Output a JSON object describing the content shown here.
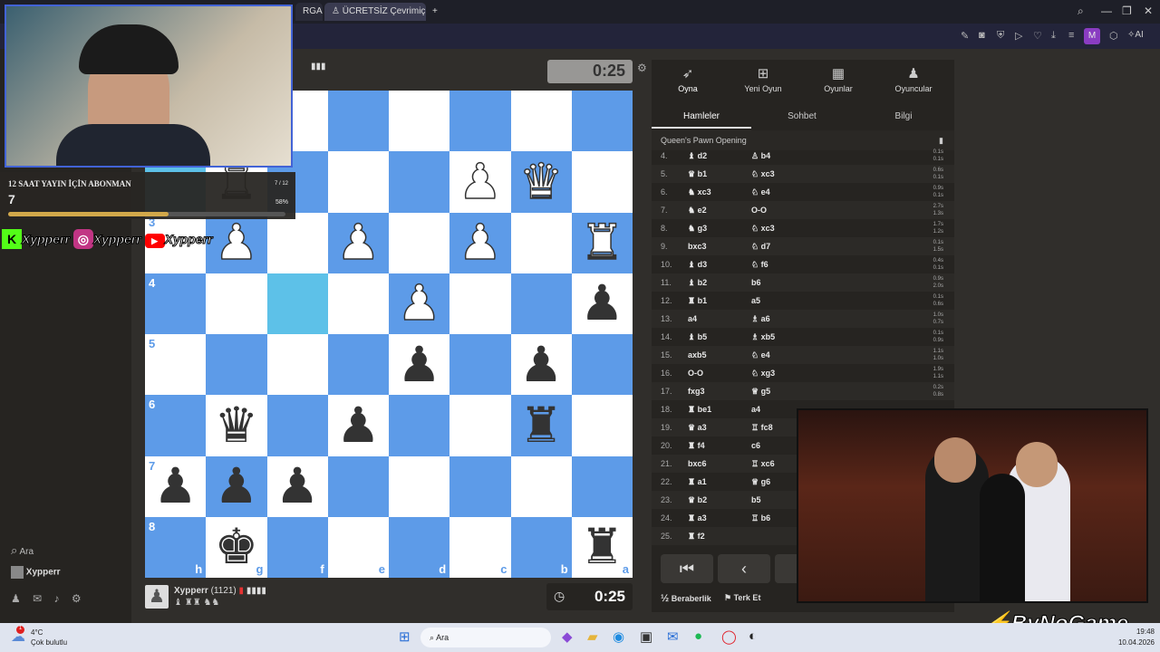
{
  "browser": {
    "tab_partial": "RGANİZ",
    "tab_active": "ÜCRETSİZ Çevrimiçi S...",
    "new_tab": "+",
    "profile_initial": "M",
    "ai_label": "AI"
  },
  "overlay": {
    "banner_title": "12 SAAT YAYIN İÇİN ABONMAN",
    "banner_count": "7",
    "banner_fraction": "7 / 12",
    "banner_percent": "58%",
    "progress": 0.58,
    "social_handles": [
      "Xypperr",
      "Xypperr",
      "Xypperr"
    ],
    "watermark": "ByNoGame"
  },
  "game": {
    "top_clock": "0:25",
    "bottom_clock": "0:25",
    "player_name": "Xypperr",
    "player_rating": "(1121)",
    "board": [
      [
        "",
        "",
        "",
        "",
        "",
        "",
        "",
        ""
      ],
      [
        "",
        "wR",
        "",
        "",
        "",
        "wP",
        "wQ",
        ""
      ],
      [
        "",
        "wP",
        "",
        "wP",
        "",
        "wP",
        "",
        "wR"
      ],
      [
        "",
        "",
        "",
        "",
        "wP",
        "",
        "",
        "bP"
      ],
      [
        "",
        "",
        "",
        "",
        "bP",
        "",
        "bP",
        ""
      ],
      [
        "",
        "bQ",
        "",
        "bP",
        "",
        "",
        "bR",
        ""
      ],
      [
        "bP",
        "bP",
        "bP",
        "",
        "",
        "",
        "",
        ""
      ],
      [
        "",
        "bK",
        "",
        "",
        "",
        "",
        "",
        "bR"
      ]
    ],
    "ranks": [
      "",
      "",
      "3",
      "4",
      "5",
      "6",
      "7",
      "8"
    ],
    "files": [
      "h",
      "g",
      "f",
      "e",
      "d",
      "c",
      "b",
      "a"
    ]
  },
  "panel": {
    "nav": [
      {
        "label": "Oyna",
        "icon": "play-icon"
      },
      {
        "label": "Yeni Oyun",
        "icon": "plus-icon"
      },
      {
        "label": "Oyunlar",
        "icon": "board-icon"
      },
      {
        "label": "Oyuncular",
        "icon": "players-icon"
      }
    ],
    "subtabs": [
      "Hamleler",
      "Sohbet",
      "Bilgi"
    ],
    "opening": "Queen's Pawn Opening",
    "moves": [
      {
        "n": "4.",
        "w": "♝ d2",
        "b": "♙ b4",
        "t1": "0.1s",
        "t2": "0.1s"
      },
      {
        "n": "5.",
        "w": "♛ b1",
        "b": "♘ xc3",
        "t1": "0.6s",
        "t2": "0.1s"
      },
      {
        "n": "6.",
        "w": "♞ xc3",
        "b": "♘ e4",
        "t1": "0.9s",
        "t2": "0.1s"
      },
      {
        "n": "7.",
        "w": "♞ e2",
        "b": "O-O",
        "t1": "2.7s",
        "t2": "1.3s"
      },
      {
        "n": "8.",
        "w": "♞ g3",
        "b": "♘ xc3",
        "t1": "1.7s",
        "t2": "1.2s"
      },
      {
        "n": "9.",
        "w": "bxc3",
        "b": "♘ d7",
        "t1": "0.1s",
        "t2": "1.5s"
      },
      {
        "n": "10.",
        "w": "♝ d3",
        "b": "♘ f6",
        "t1": "0.4s",
        "t2": "0.1s"
      },
      {
        "n": "11.",
        "w": "♝ b2",
        "b": "b6",
        "t1": "0.9s",
        "t2": "2.0s"
      },
      {
        "n": "12.",
        "w": "♜ b1",
        "b": "a5",
        "t1": "0.1s",
        "t2": "0.6s"
      },
      {
        "n": "13.",
        "w": "a4",
        "b": "♗ a6",
        "t1": "1.0s",
        "t2": "0.7s"
      },
      {
        "n": "14.",
        "w": "♝ b5",
        "b": "♗ xb5",
        "t1": "0.1s",
        "t2": "0.9s"
      },
      {
        "n": "15.",
        "w": "axb5",
        "b": "♘ e4",
        "t1": "1.1s",
        "t2": "1.0s"
      },
      {
        "n": "16.",
        "w": "O-O",
        "b": "♘ xg3",
        "t1": "1.9s",
        "t2": "1.1s"
      },
      {
        "n": "17.",
        "w": "fxg3",
        "b": "♕ g5",
        "t1": "0.2s",
        "t2": "0.8s"
      },
      {
        "n": "18.",
        "w": "♜ be1",
        "b": "a4",
        "t1": "",
        "t2": ""
      },
      {
        "n": "19.",
        "w": "♛ a3",
        "b": "♖ fc8",
        "t1": "",
        "t2": ""
      },
      {
        "n": "20.",
        "w": "♜ f4",
        "b": "c6",
        "t1": "",
        "t2": ""
      },
      {
        "n": "21.",
        "w": "bxc6",
        "b": "♖ xc6",
        "t1": "",
        "t2": ""
      },
      {
        "n": "22.",
        "w": "♜ a1",
        "b": "♕ g6",
        "t1": "",
        "t2": ""
      },
      {
        "n": "23.",
        "w": "♛ b2",
        "b": "b5",
        "t1": "",
        "t2": ""
      },
      {
        "n": "24.",
        "w": "♜ a3",
        "b": "♖ b6",
        "t1": "",
        "t2": ""
      },
      {
        "n": "25.",
        "w": "♜ f2",
        "b": "",
        "t1": "",
        "t2": ""
      }
    ],
    "draw_label": "Beraberlik",
    "resign_label": "Terk Et",
    "draw_icon": "½"
  },
  "leftnav": {
    "search": "Ara",
    "user": "Xypperr"
  },
  "taskbar": {
    "weather_temp": "4°C",
    "weather_text": "Çok bulutlu",
    "search": "Ara",
    "time": "19:48",
    "date": "10.04.2026"
  },
  "colors": {
    "board_light": "#ffffff",
    "board_dark": "#5d9be8",
    "highlight": "#5dc1e8",
    "panel_bg": "#262421"
  }
}
